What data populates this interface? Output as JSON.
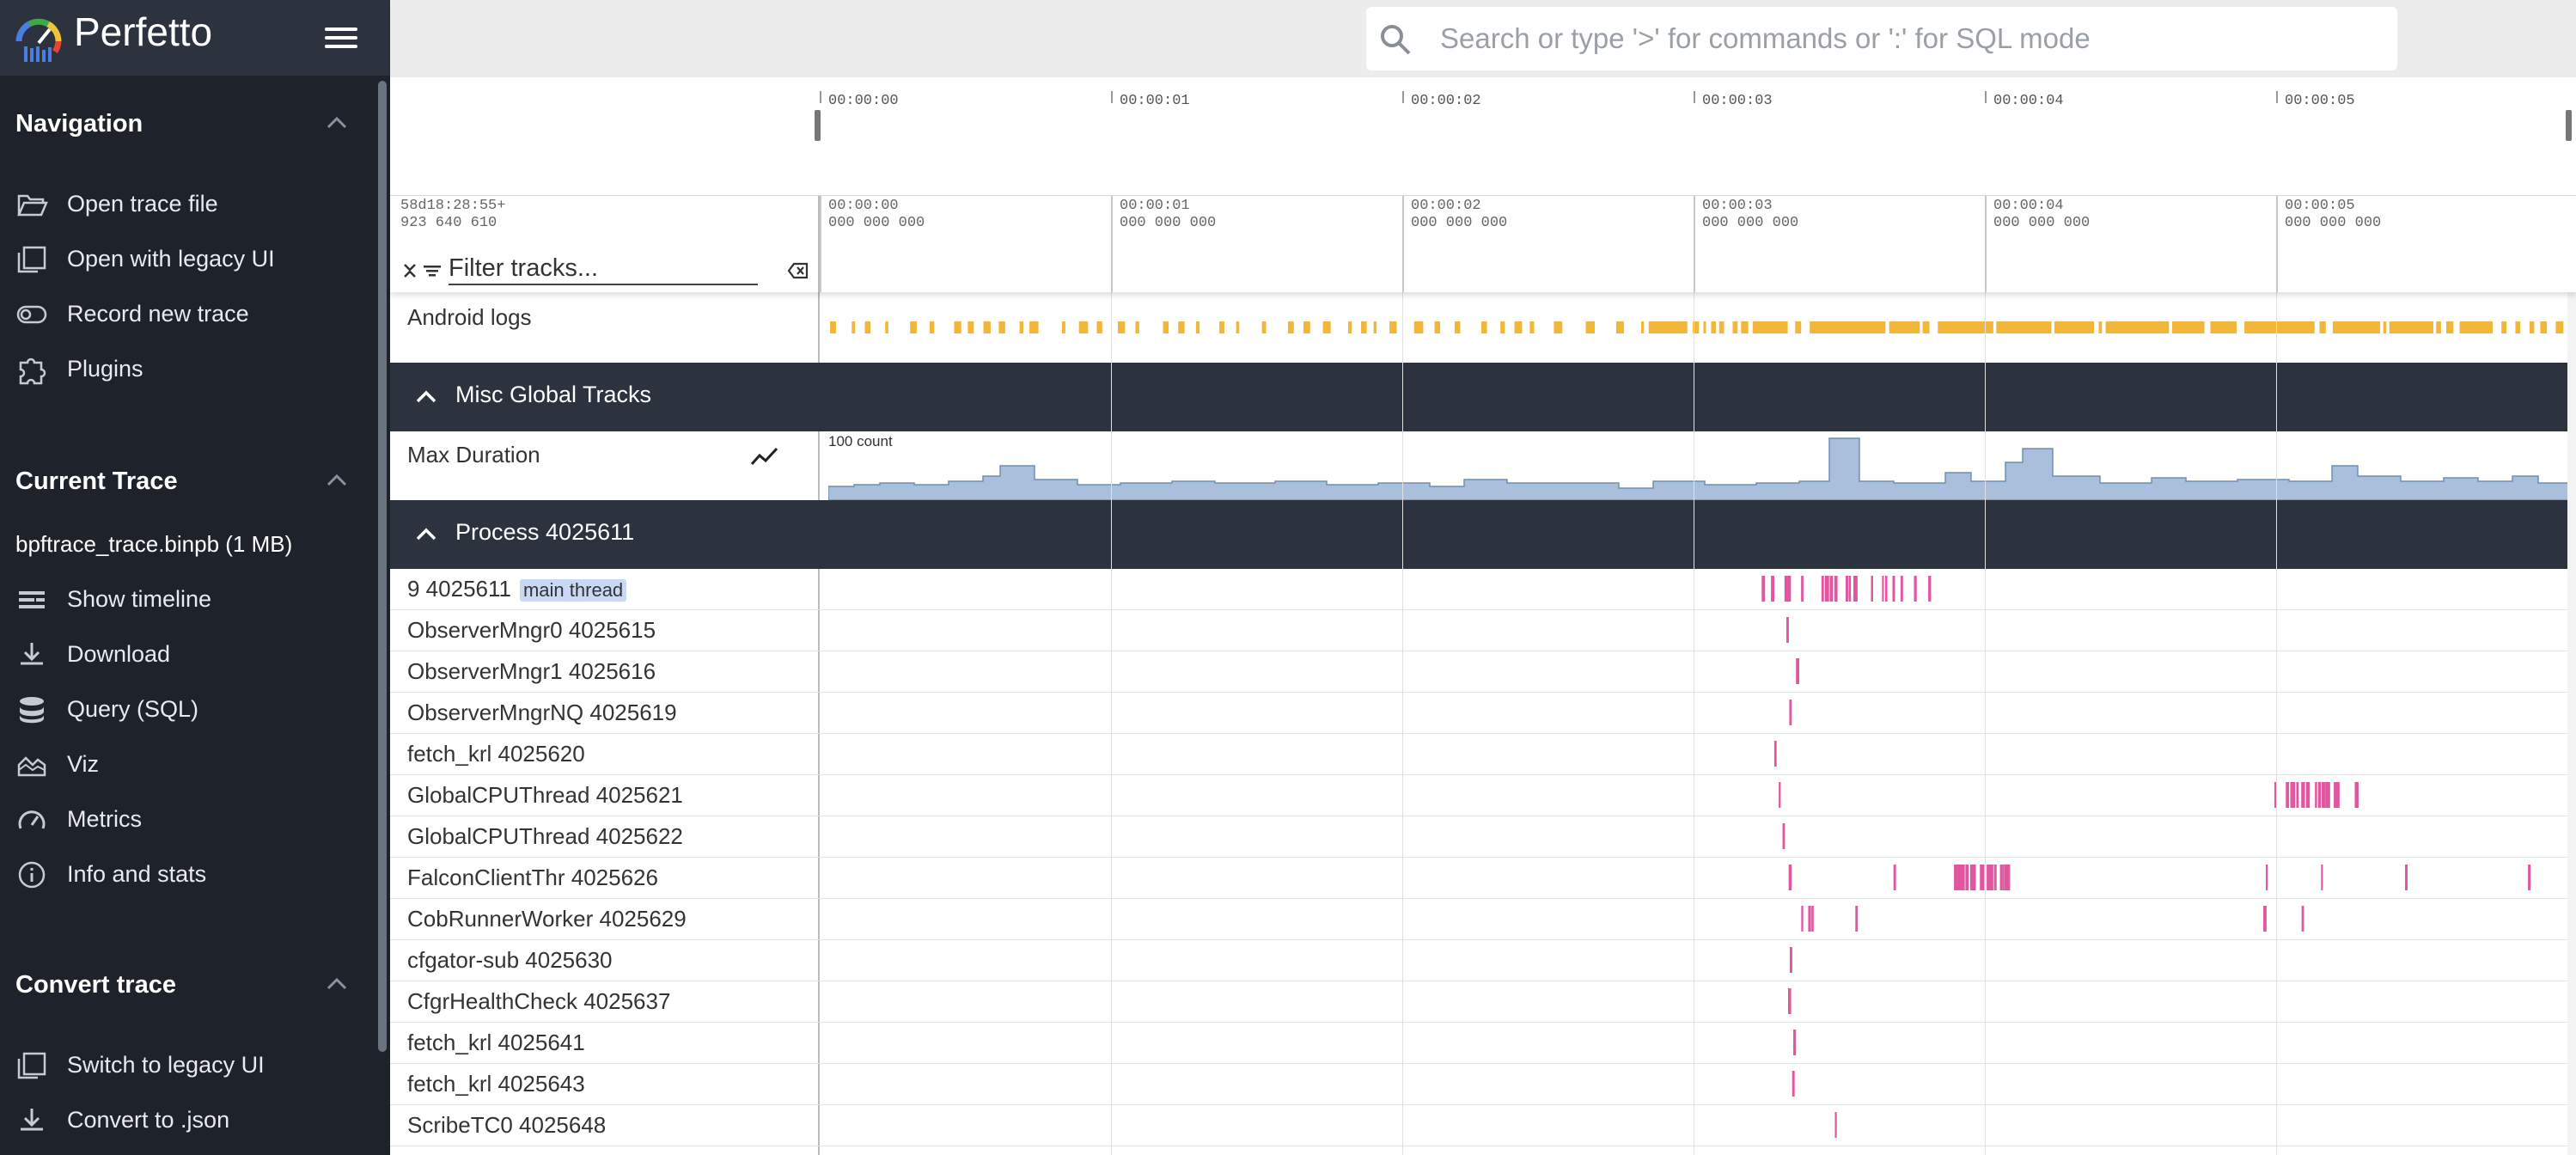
{
  "app": {
    "name": "Perfetto"
  },
  "sidebar": {
    "navigation": {
      "title": "Navigation",
      "items": [
        {
          "label": "Open trace file",
          "icon": "folder-open-icon"
        },
        {
          "label": "Open with legacy UI",
          "icon": "library-books-icon"
        },
        {
          "label": "Record new trace",
          "icon": "toggle-icon"
        },
        {
          "label": "Plugins",
          "icon": "extension-icon"
        }
      ]
    },
    "current_trace": {
      "title": "Current Trace",
      "trace_name": "bpftrace_trace.binpb (1 MB)",
      "items": [
        {
          "label": "Show timeline",
          "icon": "timeline-icon"
        },
        {
          "label": "Download",
          "icon": "download-icon"
        },
        {
          "label": "Query (SQL)",
          "icon": "database-icon"
        },
        {
          "label": "Viz",
          "icon": "area-chart-icon"
        },
        {
          "label": "Metrics",
          "icon": "speedometer-icon"
        },
        {
          "label": "Info and stats",
          "icon": "info-icon"
        }
      ]
    },
    "convert_trace": {
      "title": "Convert trace",
      "items": [
        {
          "label": "Switch to legacy UI",
          "icon": "library-books-icon"
        },
        {
          "label": "Convert to .json",
          "icon": "download-icon"
        }
      ]
    }
  },
  "search": {
    "placeholder": "Search or type '>' for commands or ':' for SQL mode"
  },
  "overview": {
    "ticks": [
      "00:00:00",
      "00:00:01",
      "00:00:02",
      "00:00:03",
      "00:00:04",
      "00:00:05"
    ]
  },
  "timeline": {
    "offset_line1": "58d18:28:55+",
    "offset_line2": "923 640 610",
    "ticks": [
      {
        "t": "00:00:00",
        "sub": "000 000 000"
      },
      {
        "t": "00:00:01",
        "sub": "000 000 000"
      },
      {
        "t": "00:00:02",
        "sub": "000 000 000"
      },
      {
        "t": "00:00:03",
        "sub": "000 000 000"
      },
      {
        "t": "00:00:04",
        "sub": "000 000 000"
      },
      {
        "t": "00:00:05",
        "sub": "000 000 000"
      }
    ],
    "filter_placeholder": "Filter tracks..."
  },
  "tracks": {
    "android_logs": {
      "label": "Android logs"
    },
    "misc_group": {
      "title": "Misc Global Tracks"
    },
    "max_duration": {
      "label": "Max Duration",
      "count_label": "100 count"
    },
    "process_group": {
      "title": "Process 4025611"
    },
    "threads": [
      {
        "label": "9 4025611",
        "badge": "main thread"
      },
      {
        "label": "ObserverMngr0 4025615"
      },
      {
        "label": "ObserverMngr1 4025616"
      },
      {
        "label": "ObserverMngrNQ 4025619"
      },
      {
        "label": "fetch_krl 4025620"
      },
      {
        "label": "GlobalCPUThread 4025621"
      },
      {
        "label": "GlobalCPUThread 4025622"
      },
      {
        "label": "FalconClientThr 4025626"
      },
      {
        "label": "CobRunnerWorker 4025629"
      },
      {
        "label": "cfgator-sub 4025630"
      },
      {
        "label": "CfgrHealthCheck 4025637"
      },
      {
        "label": "fetch_krl 4025641"
      },
      {
        "label": "fetch_krl 4025643"
      },
      {
        "label": "ScribeTC0 4025648"
      }
    ]
  },
  "colors": {
    "sidebar_bg": "#1e222b",
    "group_header_bg": "#2c323e",
    "log_marks": "#f2b73a",
    "counter_fill": "#a9bfdb",
    "slice_marks": "#e056a0"
  }
}
